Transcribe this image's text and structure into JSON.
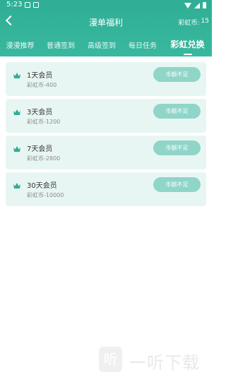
{
  "status_bar": {
    "time": "5:23"
  },
  "nav": {
    "title": "漫单福利",
    "coin_label": "彩虹币:",
    "coin_value": "15"
  },
  "tabs": [
    "漫漫推荐",
    "普通签到",
    "高级签到",
    "每日任务",
    "彩虹兑换"
  ],
  "active_tab": 4,
  "items": [
    {
      "title": "1天会员",
      "price": "彩虹币-400",
      "button": "币额不足"
    },
    {
      "title": "3天会员",
      "price": "彩虹币-1200",
      "button": "币额不足"
    },
    {
      "title": "7天会员",
      "price": "彩虹币-2800",
      "button": "币额不足"
    },
    {
      "title": "30天会员",
      "price": "彩虹币-10000",
      "button": "币额不足"
    }
  ],
  "watermark": {
    "logo": "听",
    "text": "一听下载"
  },
  "colors": {
    "header": "#35b49b",
    "item_bg": "#e8f6f3",
    "button": "#8fd5c8",
    "crown": "#2fae95"
  }
}
